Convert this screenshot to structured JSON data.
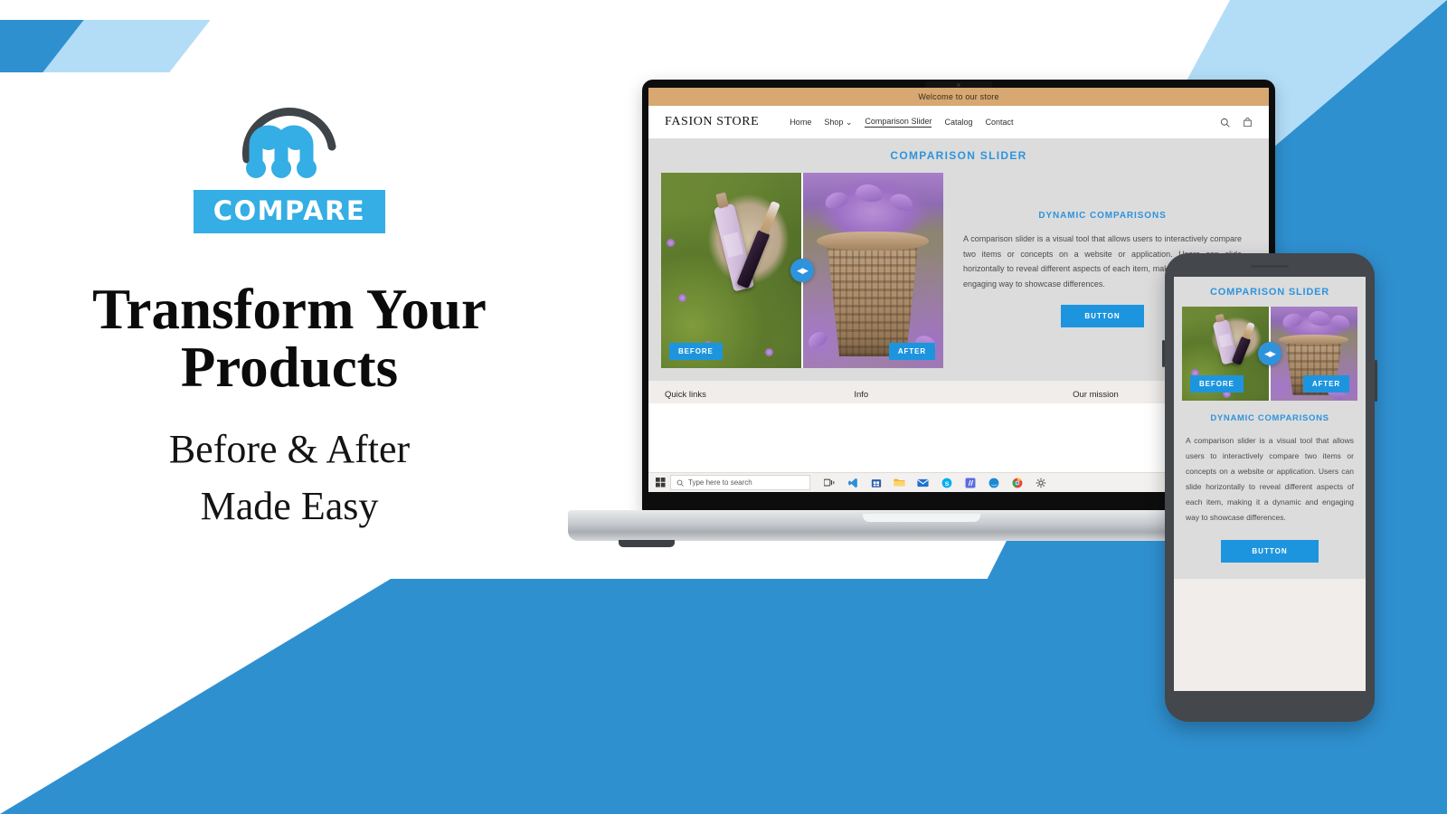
{
  "brand": {
    "logo_badge_text": "COMPARE",
    "logo_icon": "molecule-m-icon",
    "accent_blue": "#2f90d0",
    "badge_blue": "#34aee4",
    "light_blue": "#b3ddf7",
    "button_blue": "#1d95de",
    "heading_blue": "#2e93dd"
  },
  "hero_text": {
    "headline": "Transform Your Products",
    "subline_line1": "Before & After",
    "subline_line2": "Made Easy"
  },
  "store": {
    "announcement": "Welcome to our store",
    "brand_name": "FASION STORE",
    "nav": [
      {
        "label": "Home",
        "active": false,
        "has_chevron": false
      },
      {
        "label": "Shop",
        "active": false,
        "has_chevron": true
      },
      {
        "label": "Comparison Slider",
        "active": true,
        "has_chevron": false
      },
      {
        "label": "Catalog",
        "active": false,
        "has_chevron": false
      },
      {
        "label": "Contact",
        "active": false,
        "has_chevron": false
      }
    ],
    "nav_icons": [
      "search-icon",
      "cart-icon"
    ],
    "section_title": "COMPARISON SLIDER",
    "copy_title": "DYNAMIC COMPARISONS",
    "copy_body": "A comparison slider is a visual tool that allows users to interactively compare two items or concepts on a website or application. Users can slide horizontally to reveal different aspects of each item, making it a dynamic and engaging way to showcase differences.",
    "button_label": "BUTTON",
    "slider": {
      "before_label": "BEFORE",
      "after_label": "AFTER",
      "handle_icon": "left-right-arrows-icon",
      "handle_glyph": "◀▶",
      "position_percent": 50
    },
    "footer_columns": [
      "Quick links",
      "Info",
      "Our mission"
    ]
  },
  "taskbar": {
    "start_icon": "windows-start-icon",
    "search_placeholder": "Type here to search",
    "search_icon": "search-icon",
    "icons": [
      {
        "name": "task-view-icon",
        "glyph": "❐",
        "color": "#3a3a3a"
      },
      {
        "name": "vscode-icon",
        "glyph": "✄",
        "color": "#2e8fd8"
      },
      {
        "name": "microsoft-store-icon",
        "glyph": "▥",
        "color": "#2a5fa8"
      },
      {
        "name": "file-explorer-icon",
        "glyph": "▤",
        "color": "#e8b котор"
      },
      {
        "name": "mail-icon",
        "glyph": "✉",
        "color": "#1f6fd0"
      },
      {
        "name": "skype-icon",
        "glyph": "S",
        "color": "#00aff0"
      },
      {
        "name": "app-purple-icon",
        "glyph": "⫽",
        "color": "#5b6ce0"
      },
      {
        "name": "edge-icon",
        "glyph": "◉",
        "color": "#1b88d4"
      },
      {
        "name": "chrome-icon",
        "glyph": "◎",
        "color": "#e8453c"
      },
      {
        "name": "settings-gear-icon",
        "glyph": "⚙",
        "color": "#4a4a4a"
      }
    ]
  },
  "phone": {
    "section_title": "COMPARISON SLIDER",
    "copy_title": "DYNAMIC COMPARISONS",
    "copy_body": "A comparison slider is a visual tool that allows users to interactively compare two items or concepts on a website or application. Users can slide horizontally to reveal different aspects of each item, making it a dynamic and engaging way to showcase differences.",
    "button_label": "BUTTON",
    "before_label": "BEFORE",
    "after_label": "AFTER",
    "handle_glyph": "◀▶"
  }
}
